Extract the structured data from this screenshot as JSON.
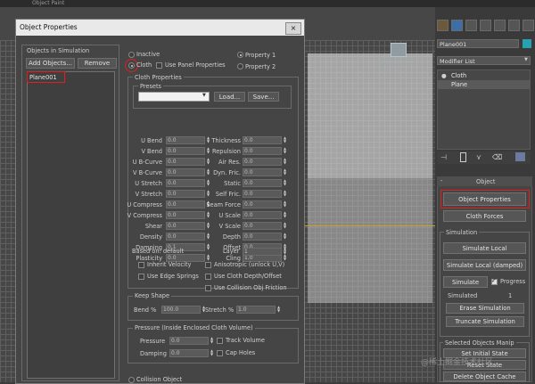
{
  "topbar": {
    "title": "Object Paint"
  },
  "dialog": {
    "title": "Object Properties",
    "close_glyph": "×",
    "objects_header": "Objects in Simulation",
    "add_objects": "Add Objects...",
    "remove": "Remove",
    "objects": [
      "Plane001"
    ],
    "mode": {
      "inactive": "Inactive",
      "cloth": "Cloth",
      "use_panel": "Use Panel Properties",
      "property1": "Property 1",
      "property2": "Property 2"
    },
    "cloth_properties": "Cloth Properties",
    "presets": "Presets",
    "load": "Load...",
    "save": "Save...",
    "left_params": [
      {
        "label": "U Bend",
        "value": "0.0"
      },
      {
        "label": "V Bend",
        "value": "0.0"
      },
      {
        "label": "U B-Curve",
        "value": "0.0"
      },
      {
        "label": "V B-Curve",
        "value": "0.0"
      },
      {
        "label": "U Stretch",
        "value": "0.0"
      },
      {
        "label": "V Stretch",
        "value": "0.0"
      },
      {
        "label": "U Compress",
        "value": "0.0"
      },
      {
        "label": "V Compress",
        "value": "0.0"
      },
      {
        "label": "Shear",
        "value": "0.0"
      },
      {
        "label": "Density",
        "value": "0.0"
      },
      {
        "label": "Damping",
        "value": "0.1"
      },
      {
        "label": "Plasticity",
        "value": "0.0"
      }
    ],
    "right_params": [
      {
        "label": "Thickness",
        "value": "0.0"
      },
      {
        "label": "Repulsion",
        "value": "0.0"
      },
      {
        "label": "Air Res.",
        "value": "0.0"
      },
      {
        "label": "Dyn. Fric.",
        "value": "0.0"
      },
      {
        "label": "Static",
        "value": "0.0"
      },
      {
        "label": "Self Fric.",
        "value": "0.0"
      },
      {
        "label": "Seam Force",
        "value": "0.0"
      },
      {
        "label": "U Scale",
        "value": "0.0"
      },
      {
        "label": "V Scale",
        "value": "0.0"
      },
      {
        "label": "Depth",
        "value": "0.0"
      },
      {
        "label": "Offset",
        "value": "0.0"
      },
      {
        "label": "Cling",
        "value": "1.0"
      }
    ],
    "based_on": "Based on: default",
    "layer_label": "Layer",
    "layer_value": "1",
    "checks": {
      "inherit_velocity": "Inherit Velocity",
      "anisotropic": "Anisotropic (unlock U,V)",
      "use_edge_springs": "Use Edge Springs",
      "use_cloth_depth": "Use Cloth Depth/Offset",
      "use_collision_obj": "Use Collision Obj Friction"
    },
    "keep_shape": {
      "title": "Keep Shape",
      "bend_label": "Bend %",
      "bend_value": "100.0",
      "stretch_label": "Stretch %",
      "stretch_value": "1.0"
    },
    "pressure": {
      "title": "Pressure (Inside Enclosed Cloth Volume)",
      "pressure_label": "Pressure",
      "pressure_value": "0.0",
      "damping_label": "Damping",
      "damping_value": "0.0",
      "track_volume": "Track Volume",
      "cap_holes": "Cap Holes"
    },
    "collision_object": "Collision Object"
  },
  "panel": {
    "object_name": "Plane001",
    "modifier_list": "Modifier List",
    "stack": [
      {
        "label": "Cloth"
      },
      {
        "label": "Plane"
      }
    ],
    "object_rollout": "Object",
    "object_properties": "Object Properties",
    "cloth_forces": "Cloth Forces",
    "simulation_header": "Simulation",
    "simulate_local": "Simulate Local",
    "simulate_local_damped": "Simulate Local (damped)",
    "simulate": "Simulate",
    "progress": "Progress",
    "simulated_label": "Simulated",
    "simulated_value": "1",
    "erase_simulation": "Erase Simulation",
    "truncate_simulation": "Truncate Simulation",
    "selected_objects_header": "Selected Objects Manip",
    "set_initial_state": "Set Initial State",
    "reset_state": "Reset State",
    "delete_object_cache": "Delete Object Cache"
  },
  "watermark": "@稀土掘金技术社区"
}
